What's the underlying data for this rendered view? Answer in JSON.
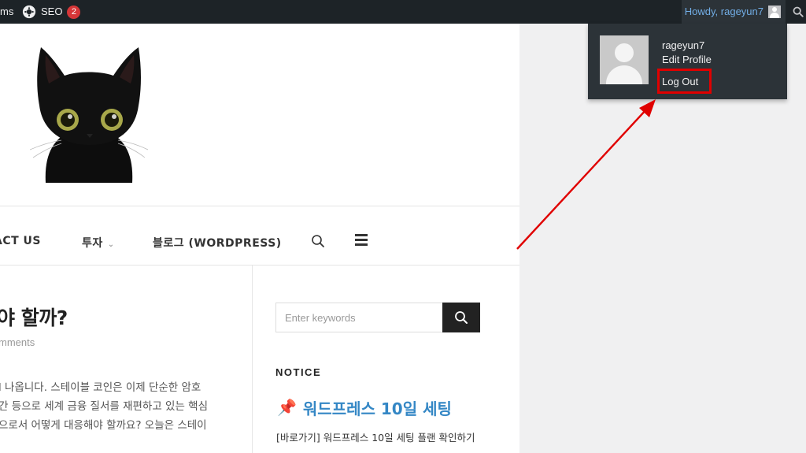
{
  "admin_bar": {
    "items_label": "ms",
    "seo_label": "SEO",
    "seo_badge": "2",
    "howdy": "Howdy, rageyun7"
  },
  "account_menu": {
    "username": "rageyun7",
    "edit_profile": "Edit Profile",
    "log_out": "Log Out"
  },
  "site": {
    "nav": {
      "contact": "ACT US",
      "invest": "투자",
      "blog": "블로그 (WORDPRESS)"
    },
    "post": {
      "title": "야 할까?",
      "comments": "mments",
      "excerpt_lines": [
        "l 나옵니다. 스테이블 코인은 이제 단순한 암호",
        "간 등으로 세계 금융 질서를 재편하고 있는 핵심",
        "으로서 어떻게 대응해야 할까요? 오늘은 스테이"
      ]
    },
    "sidebar": {
      "search_placeholder": "Enter keywords",
      "notice_title": "NOTICE",
      "notice_heading": "워드프레스 10일 세팅",
      "notice_link": "[바로가기] 워드프레스 10일 세팅 플랜 확인하기"
    }
  },
  "annotation": {
    "highlight_color": "#e00000"
  }
}
